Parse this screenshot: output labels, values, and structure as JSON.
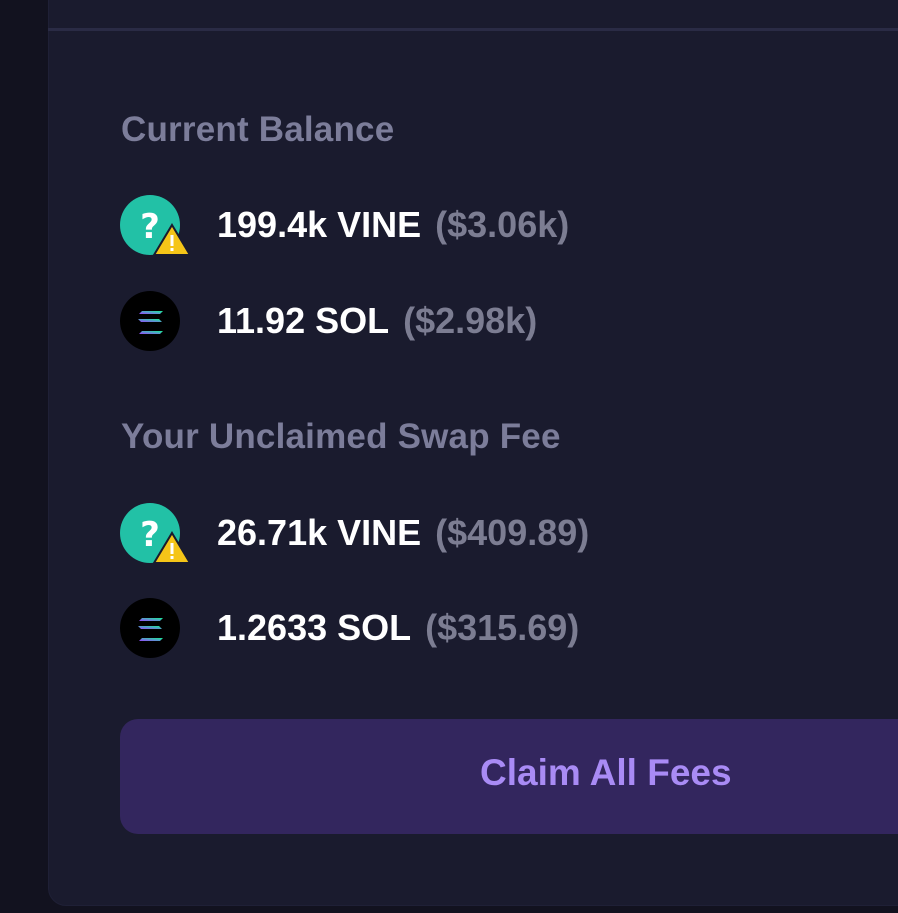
{
  "balance": {
    "title": "Current Balance",
    "tokens": [
      {
        "icon": "unknown-token-warning-icon",
        "amount": "199.4k VINE",
        "usd": "($3.06k)"
      },
      {
        "icon": "solana-icon",
        "amount": "11.92 SOL",
        "usd": "($2.98k)"
      }
    ]
  },
  "fees": {
    "title": "Your Unclaimed Swap Fee",
    "tokens": [
      {
        "icon": "unknown-token-warning-icon",
        "amount": "26.71k VINE",
        "usd": "($409.89)"
      },
      {
        "icon": "solana-icon",
        "amount": "1.2633 SOL",
        "usd": "($315.69)"
      }
    ]
  },
  "claim_button": {
    "label": "Claim All Fees"
  },
  "colors": {
    "background": "#12121f",
    "panel": "#1a1b2e",
    "muted_text": "#7c7d9a",
    "accent_button": "#33265e",
    "accent_text": "#a98bf5",
    "unknown_token": "#22c1a6",
    "warning": "#f5c518"
  }
}
